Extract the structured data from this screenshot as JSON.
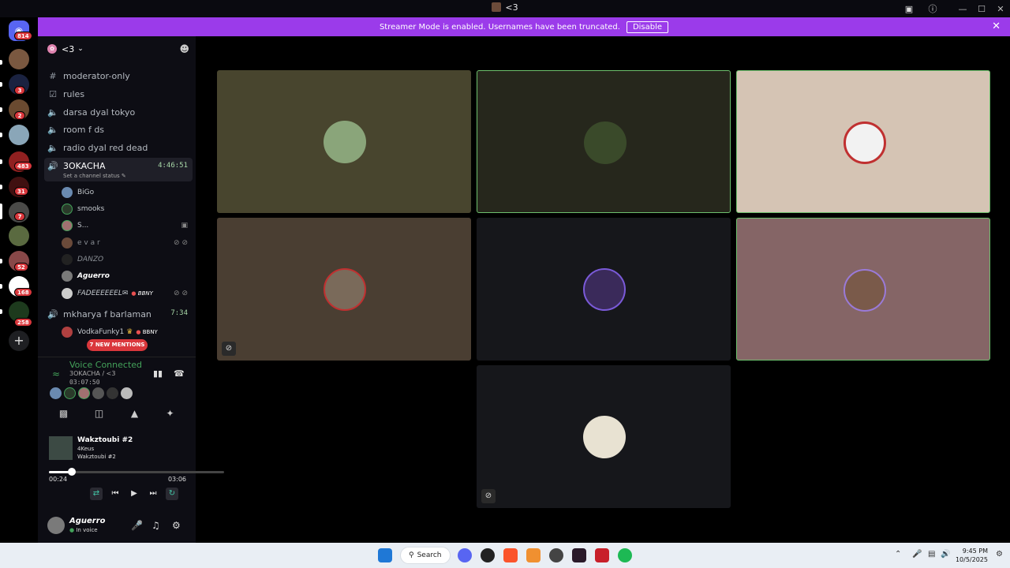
{
  "window": {
    "title": "<3"
  },
  "banner": {
    "text": "Streamer Mode is enabled. Usernames have been truncated.",
    "disable_label": "Disable"
  },
  "guilds": {
    "home_badge": "814",
    "badges": [
      "3",
      "2",
      "483",
      "31",
      "7",
      "52",
      "168",
      "258"
    ]
  },
  "server": {
    "name": "<3"
  },
  "channels": [
    {
      "icon": "hash",
      "name": "moderator-only"
    },
    {
      "icon": "rules",
      "name": "rules"
    },
    {
      "icon": "voice",
      "name": "darsa dyal tokyo"
    },
    {
      "icon": "voice",
      "name": "room f ds"
    },
    {
      "icon": "voice",
      "name": "radio dyal red dead"
    }
  ],
  "active_channel": {
    "name": "3OKACHA",
    "timer": "4:46:51",
    "status": "Set a channel status"
  },
  "members": [
    {
      "name": "BiGo"
    },
    {
      "name": "smooks"
    },
    {
      "name": "S..."
    },
    {
      "name": "e v a r"
    },
    {
      "name": "DANZO"
    },
    {
      "name": "Aguerro"
    },
    {
      "name": "FADEEEEEEL✉",
      "tag": "BBNY"
    }
  ],
  "second_channel": {
    "name": "mkharya f barlaman",
    "timer": "7:34"
  },
  "second_members": [
    {
      "name": "VodkaFunky1",
      "tag": "BBNY"
    }
  ],
  "mentions_label": "7 NEW MENTIONS",
  "voice": {
    "title": "Voice Connected",
    "location": "3OKACHA / <3",
    "elapsed": "03:07:50"
  },
  "music": {
    "title": "Wakztoubi #2",
    "artist": "4Keus",
    "album": "Wakztoubi #2",
    "current": "00:24",
    "total": "03:06",
    "progress": 0.13
  },
  "user": {
    "name": "Aguerro",
    "status": "In voice"
  },
  "taskbar": {
    "search": "Search",
    "time": "9:45 PM",
    "date": "10/5/2025"
  },
  "colors": {
    "banner": "#9b3bea",
    "speaking": "#6dc06d",
    "badge": "#da373c",
    "voice_green": "#43a25a"
  }
}
